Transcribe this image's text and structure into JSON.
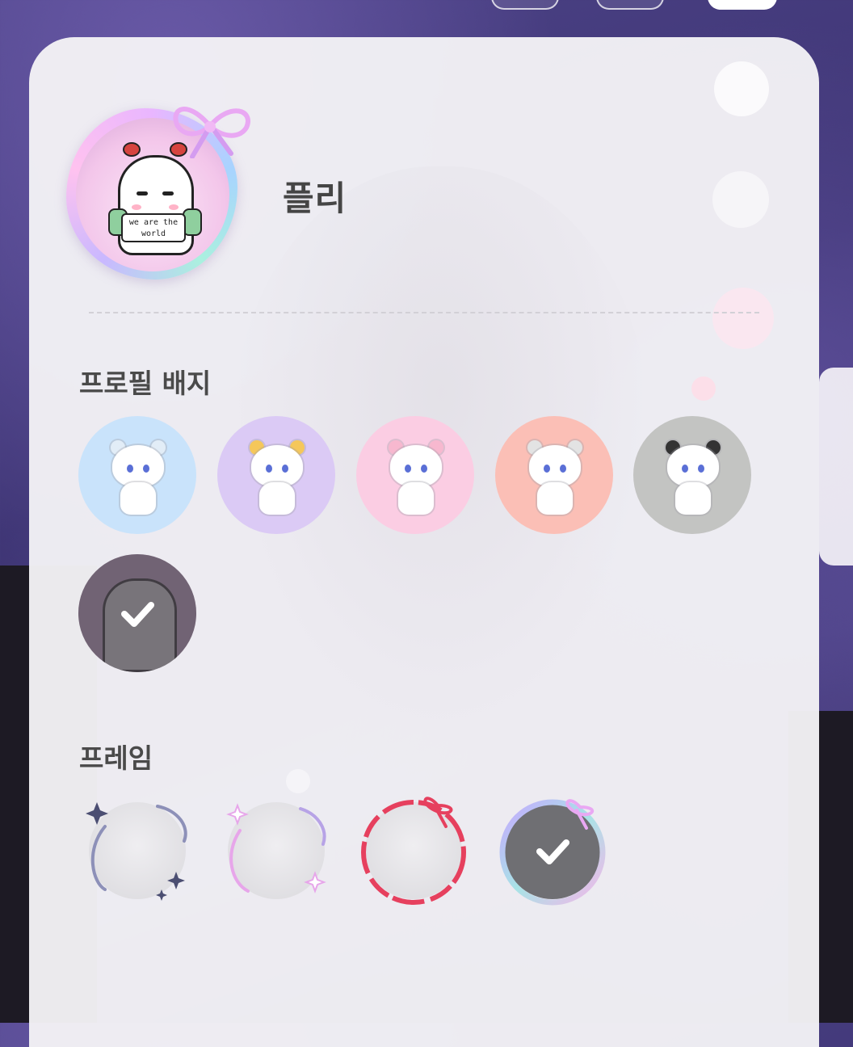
{
  "profile": {
    "nickname": "플리",
    "avatar_sign_text": "we are the world"
  },
  "sections": {
    "badges_title": "프로필 배지",
    "frames_title": "프레임"
  },
  "badges": [
    {
      "name": "blue-bear-badge",
      "bg": "#c9e3fb",
      "ear": "#e2edf7",
      "selected": false
    },
    {
      "name": "purple-bear-badge",
      "bg": "#dbcaf5",
      "ear": "#f5c75a",
      "selected": false
    },
    {
      "name": "pink-bear-badge",
      "bg": "#fbcde3",
      "ear": "#f7b8cf",
      "selected": false
    },
    {
      "name": "coral-bear-badge",
      "bg": "#fbbfb6",
      "ear": "#e3e3e3",
      "selected": false
    },
    {
      "name": "gray-panda-badge",
      "bg": "#c3c4c2",
      "ear": "#333333",
      "selected": false
    },
    {
      "name": "girl-character-badge",
      "bg": "#8d7a8e",
      "selected": true
    }
  ],
  "frames": [
    {
      "name": "sparkle-dark-frame",
      "color": "#4b4e72",
      "selected": false
    },
    {
      "name": "sparkle-pink-frame",
      "color": "#e7a6ea",
      "selected": false
    },
    {
      "name": "red-ribbon-frame",
      "color": "#e6405e",
      "selected": false
    },
    {
      "name": "pastel-ribbon-frame",
      "color": "#c6a8ff",
      "selected": true
    }
  ],
  "colors": {
    "panel_bg": "#f4f3f6",
    "text_primary": "#454545",
    "check_overlay": "#6f6f73"
  },
  "icons": {
    "selected_marker": "check-icon"
  }
}
